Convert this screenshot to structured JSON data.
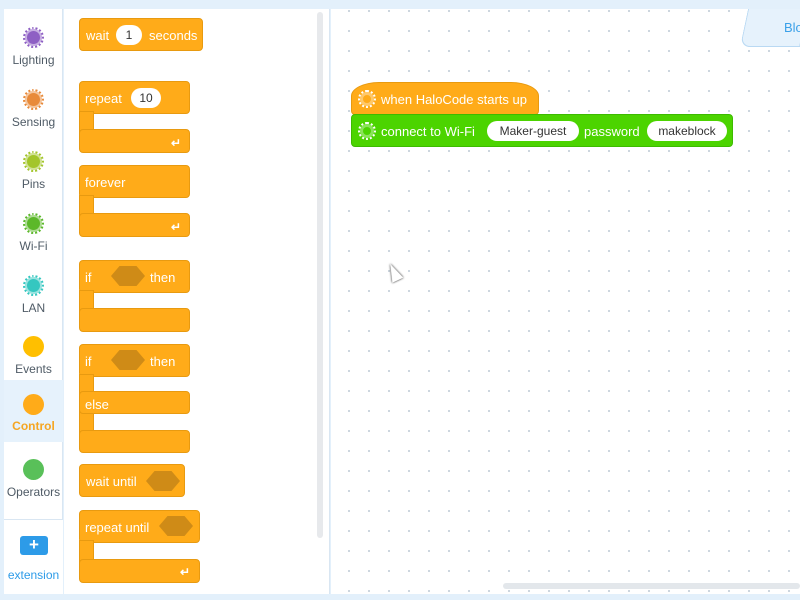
{
  "colors": {
    "control": "#ffab19",
    "wifi_block": "#4cd400",
    "accent": "#2d9be8",
    "control_label": "#f5a623"
  },
  "categories": [
    {
      "label": "Lighting",
      "color": "#8e5fc4",
      "icon": "lighting-dots-icon"
    },
    {
      "label": "Sensing",
      "color": "#e88a3a",
      "icon": "sensing-dots-icon"
    },
    {
      "label": "Pins",
      "color": "#a3c52a",
      "icon": "pins-dots-icon"
    },
    {
      "label": "Wi-Fi",
      "color": "#5cb82a",
      "icon": "wifi-dots-icon"
    },
    {
      "label": "LAN",
      "color": "#35c7c0",
      "icon": "lan-dots-icon"
    },
    {
      "label": "Events",
      "color": "#ffbf00"
    },
    {
      "label": "Control",
      "color": "#ffab19",
      "active": true
    },
    {
      "label": "Operators",
      "color": "#59c059"
    }
  ],
  "extension": {
    "label": "extension",
    "icon": "add-extension-icon"
  },
  "palette": {
    "wait": {
      "pre": "wait",
      "value": "1",
      "post": "seconds"
    },
    "repeat": {
      "label": "repeat",
      "value": "10"
    },
    "forever": {
      "label": "forever"
    },
    "if_then": {
      "if": "if",
      "then": "then"
    },
    "if_else": {
      "if": "if",
      "then": "then",
      "else": "else"
    },
    "wait_until": {
      "label": "wait until"
    },
    "repeat_until": {
      "label": "repeat until"
    }
  },
  "workspace": {
    "tab_label": "Blo",
    "hat": {
      "label": "when HaloCode starts up"
    },
    "wifi": {
      "pre": "connect to Wi-Fi",
      "ssid": "Maker-guest",
      "mid": "password",
      "pass": "makeblock"
    }
  }
}
